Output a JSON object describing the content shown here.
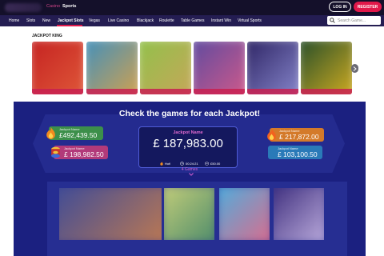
{
  "header": {
    "nav": [
      "Casino",
      "Sports"
    ],
    "login_label": "LOG IN",
    "register_label": "REGISTER"
  },
  "menu": {
    "items": [
      "Home",
      "Slots",
      "New",
      "Jackpot Slots",
      "Vegas",
      "Live Casino",
      "Blackjack",
      "Roulette",
      "Table Games",
      "Instant Win",
      "Virtual Sports"
    ],
    "active": "Jackpot Slots",
    "search_placeholder": "Search Game..."
  },
  "section": {
    "title": "JACKPOT KING",
    "tiles": [
      {
        "color_a": "#c42020",
        "color_b": "#e05a3a"
      },
      {
        "color_a": "#3c8fc0",
        "color_b": "#d8a24a"
      },
      {
        "color_a": "#8fc24a",
        "color_b": "#c9a55a"
      },
      {
        "color_a": "#5a4aa0",
        "color_b": "#d45a8a"
      },
      {
        "color_a": "#2a2060",
        "color_b": "#8a8ad0"
      },
      {
        "color_a": "#1f4a2a",
        "color_b": "#d8b020"
      }
    ]
  },
  "jackpot": {
    "title": "Check the games for each Jackpot!",
    "left_cards": [
      {
        "name": "Jackpot Name",
        "amount": "£492,439.50",
        "color": "#3c8f4a"
      },
      {
        "name": "Jackpot Name",
        "amount": "£ 198,982.50",
        "color": "#b23a7a"
      }
    ],
    "center": {
      "name": "Jackpot Name",
      "amount": "£ 187,983.00",
      "status": "Hot!",
      "time": "00:24:21",
      "min": "£50.00"
    },
    "right_cards": [
      {
        "name": "Jackpot Name",
        "amount": "£ 217,872.00",
        "color": "#d47a2a"
      },
      {
        "name": "Jackpot Name",
        "amount": "£ 103,100.50",
        "color": "#2a7ab8"
      }
    ],
    "games_count": "4 Games"
  },
  "games": [
    {
      "color_a": "#3a4a9a",
      "color_b": "#c07a50"
    },
    {
      "color_a": "#c8d07a",
      "color_b": "#4a8a6a"
    },
    {
      "color_a": "#4ab0e0",
      "color_b": "#e06a8a"
    },
    {
      "color_a": "#3a2a7a",
      "color_b": "#c0b0e0"
    }
  ]
}
